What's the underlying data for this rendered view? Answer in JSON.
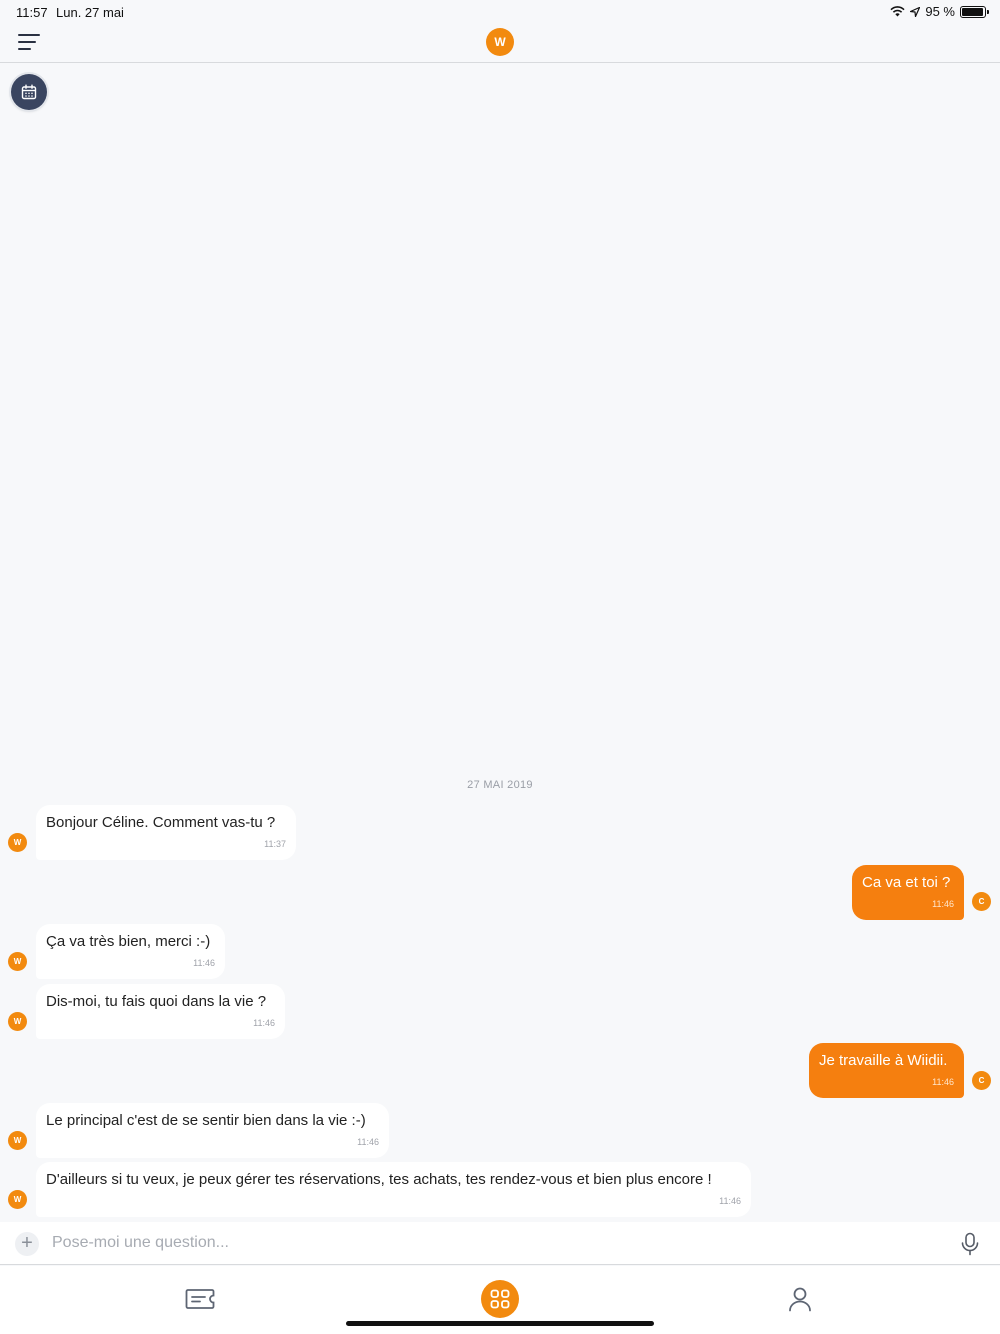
{
  "status_bar": {
    "time": "11:57",
    "date": "Lun. 27 mai",
    "battery": "95 %",
    "battery_level": 0.95
  },
  "header": {
    "logo_letter": "W",
    "menu_icon": "hamburger-menu-icon",
    "calendar_icon": "calendar-icon"
  },
  "conversation": {
    "date_separator": "27 MAI 2019",
    "messages": [
      {
        "sender": "bot",
        "avatar": "W",
        "text": "Bonjour Céline. Comment vas-tu ?",
        "time": "11:37"
      },
      {
        "sender": "user",
        "avatar": "C",
        "text": "Ca va et toi ?",
        "time": "11:46"
      },
      {
        "sender": "bot",
        "avatar": "W",
        "text": "Ça va très bien, merci :-)",
        "time": "11:46"
      },
      {
        "sender": "bot",
        "avatar": "W",
        "text": "Dis-moi, tu fais quoi dans la vie ?",
        "time": "11:46"
      },
      {
        "sender": "user",
        "avatar": "C",
        "text": "Je travaille à Wiidii.",
        "time": "11:46"
      },
      {
        "sender": "bot",
        "avatar": "W",
        "text": "Le principal c'est de se sentir bien dans la vie :-)",
        "time": "11:46"
      },
      {
        "sender": "bot",
        "avatar": "W",
        "text": "D'ailleurs si tu veux, je peux gérer tes réservations, tes achats, tes rendez-vous et bien plus encore !",
        "time": "11:46"
      }
    ]
  },
  "composer": {
    "placeholder": "Pose-moi une question...",
    "plus_label": "+"
  },
  "tabbar": {
    "tabs": [
      "ticket-icon",
      "apps-grid-icon",
      "profile-icon"
    ]
  },
  "colors": {
    "accent": "#f28a0f",
    "user_bubble": "#f57f0f",
    "background": "#f7f8fa"
  }
}
